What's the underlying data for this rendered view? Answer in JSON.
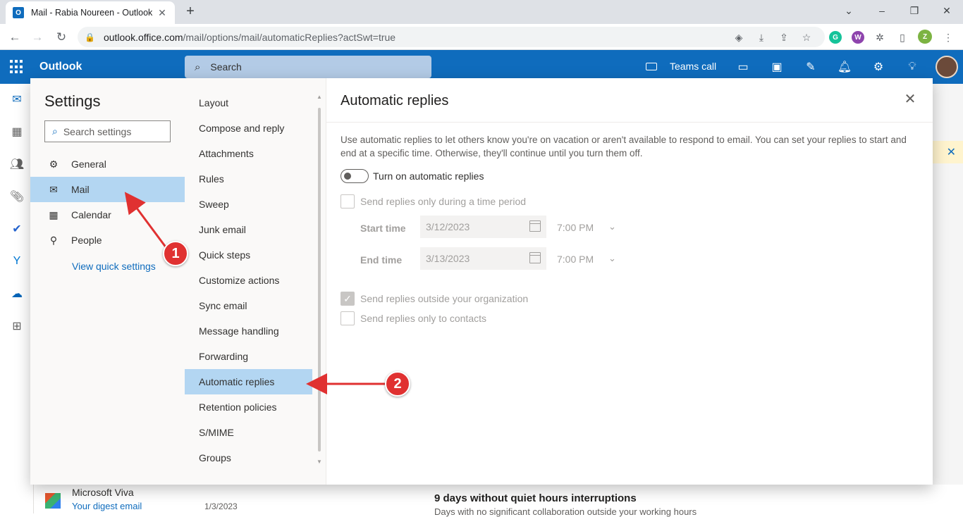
{
  "browser": {
    "tab_title": "Mail - Rabia Noureen - Outlook",
    "favicon_text": "O",
    "tab_close": "✕",
    "new_tab": "+",
    "url_host": "outlook.office.com",
    "url_path": "/mail/options/mail/automaticReplies?actSwt=true",
    "profile_initial": "Z",
    "ext_g": "G",
    "ext_w": "W"
  },
  "outlook": {
    "brand": "Outlook",
    "search_placeholder": "Search",
    "teams_call": "Teams call"
  },
  "settings": {
    "title": "Settings",
    "search_placeholder": "Search settings",
    "categories": [
      {
        "label": "General",
        "icon": "gear-icon"
      },
      {
        "label": "Mail",
        "icon": "mail-icon"
      },
      {
        "label": "Calendar",
        "icon": "calendar-icon"
      },
      {
        "label": "People",
        "icon": "people-icon"
      }
    ],
    "quick_settings_link": "View quick settings",
    "mail_subitems": [
      "Layout",
      "Compose and reply",
      "Attachments",
      "Rules",
      "Sweep",
      "Junk email",
      "Quick steps",
      "Customize actions",
      "Sync email",
      "Message handling",
      "Forwarding",
      "Automatic replies",
      "Retention policies",
      "S/MIME",
      "Groups"
    ],
    "selected_category": "Mail",
    "selected_subitem": "Automatic replies"
  },
  "auto_replies": {
    "title": "Automatic replies",
    "description": "Use automatic replies to let others know you're on vacation or aren't available to respond to email. You can set your replies to start and end at a specific time. Otherwise, they'll continue until you turn them off.",
    "toggle_label": "Turn on automatic replies",
    "toggle_on": false,
    "time_period_label": "Send replies only during a time period",
    "start_time_label": "Start time",
    "start_date": "3/12/2023",
    "start_time": "7:00 PM",
    "end_time_label": "End time",
    "end_date": "3/13/2023",
    "end_time": "7:00 PM",
    "outside_org_label": "Send replies outside your organization",
    "outside_org_checked": true,
    "contacts_only_label": "Send replies only to contacts",
    "contacts_only_checked": false
  },
  "background": {
    "sender": "Microsoft Viva",
    "subject": "Your digest email",
    "date": "1/3/2023",
    "headline": "9 days without quiet hours interruptions",
    "subline": "Days with no significant collaboration outside your working hours"
  },
  "annotations": {
    "step1": "1",
    "step2": "2",
    "color": "#e03131"
  },
  "colors": {
    "brand_blue": "#0f6cbd",
    "selected_bg": "#b3d6f2"
  }
}
